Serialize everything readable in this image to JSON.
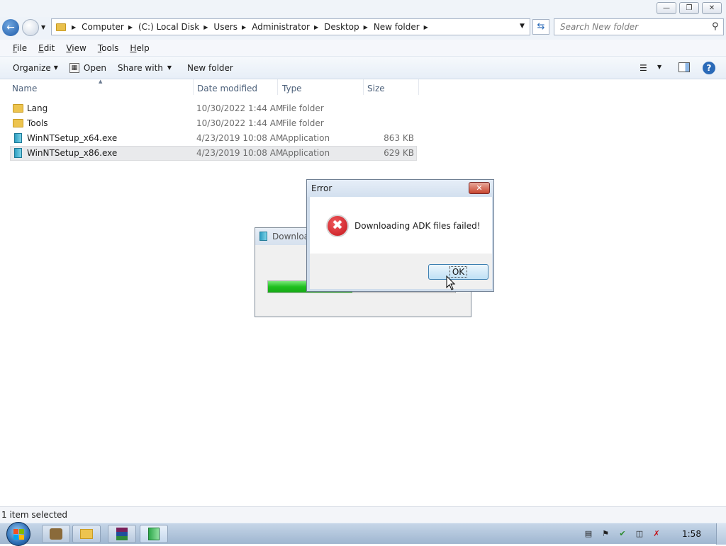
{
  "address": {
    "crumbs": [
      "Computer",
      "(C:) Local Disk",
      "Users",
      "Administrator",
      "Desktop",
      "New folder"
    ],
    "search_placeholder": "Search New folder"
  },
  "menu": [
    "File",
    "Edit",
    "View",
    "Tools",
    "Help"
  ],
  "toolbar": {
    "organize": "Organize",
    "open": "Open",
    "share_with": "Share with",
    "new_folder": "New folder"
  },
  "columns": {
    "name": "Name",
    "date": "Date modified",
    "type": "Type",
    "size": "Size"
  },
  "files": [
    {
      "name": "Lang",
      "date": "10/30/2022 1:44 AM",
      "type": "File folder",
      "size": "",
      "icon": "folder-icon"
    },
    {
      "name": "Tools",
      "date": "10/30/2022 1:44 AM",
      "type": "File folder",
      "size": "",
      "icon": "folder-icon"
    },
    {
      "name": "WinNTSetup_x64.exe",
      "date": "4/23/2019 10:08 AM",
      "type": "Application",
      "size": "863 KB",
      "icon": "application-icon"
    },
    {
      "name": "WinNTSetup_x86.exe",
      "date": "4/23/2019 10:08 AM",
      "type": "Application",
      "size": "629 KB",
      "icon": "application-icon"
    }
  ],
  "progress_window": {
    "title": "Downloa",
    "progress": 0.45
  },
  "error_dialog": {
    "title": "Error",
    "message": "Downloading ADK files failed!",
    "ok_label": "OK"
  },
  "status": {
    "text": "1 item selected"
  },
  "taskbar": {
    "clock": "1:58"
  },
  "colors": {
    "accent": "#3c7fb1",
    "error_red": "#c4161c",
    "progress_green": "#1fbf1f"
  }
}
